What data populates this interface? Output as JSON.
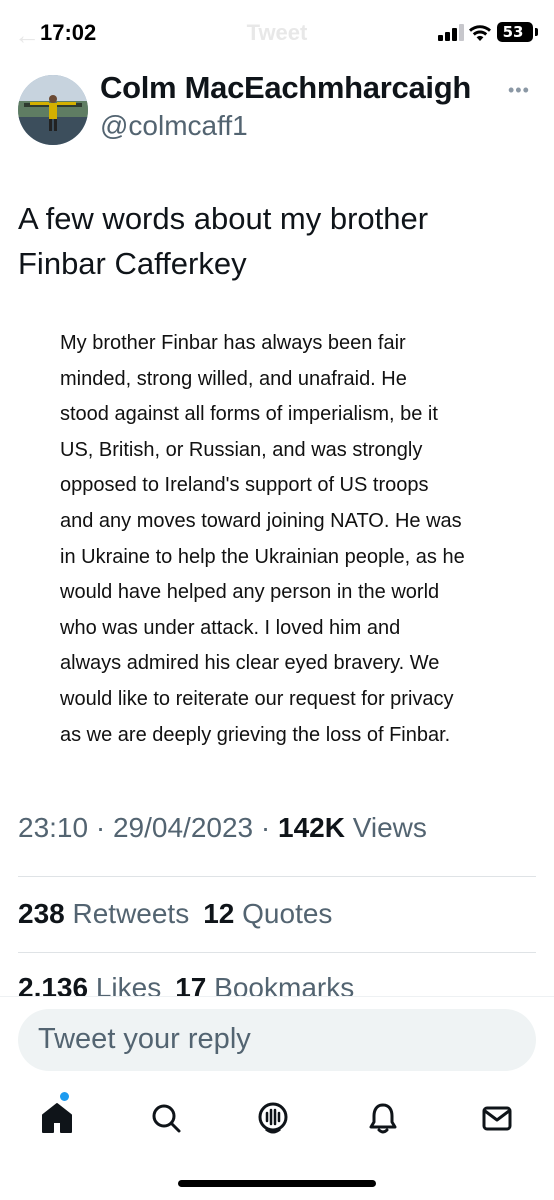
{
  "status_bar": {
    "time": "17:02",
    "battery": "53"
  },
  "nav": {
    "title": "Tweet",
    "back_icon": "back-arrow-icon"
  },
  "tweet": {
    "author": {
      "display_name": "Colm MacEachmharcaigh",
      "handle": "@colmcaff1"
    },
    "more_label": "•••",
    "text_lines": [
      "A few words about my brother",
      "Finbar Cafferkey"
    ],
    "attached_text_lines": [
      "My brother Finbar has always been fair",
      "minded, strong willed, and unafraid. He",
      "stood against all forms of imperialism, be it",
      "US, British, or Russian, and was strongly",
      "opposed to Ireland's support of US troops",
      "and any moves toward joining NATO. He was",
      "in Ukraine to help the Ukrainian people, as he",
      "would have helped any person in the world",
      "who was under attack. I loved him and",
      "always admired his clear eyed bravery. We",
      "would like to reiterate our request for privacy",
      "as we are deeply grieving the loss of Finbar."
    ],
    "meta": {
      "time": "23:10",
      "sep1": " · ",
      "date": "29/04/2023",
      "sep2": " · ",
      "views_count": "142K",
      "views_label": " Views"
    },
    "stats": {
      "retweets_count": "238",
      "retweets_label": " Retweets",
      "quotes_count": "12",
      "quotes_label": " Quotes",
      "likes_count": "2,136",
      "likes_label": " Likes",
      "bookmarks_count": "17",
      "bookmarks_label": " Bookmarks"
    }
  },
  "reply": {
    "placeholder": "Tweet your reply"
  },
  "tab_bar": {
    "items": [
      {
        "icon": "home-icon",
        "active": true
      },
      {
        "icon": "search-icon",
        "active": false
      },
      {
        "icon": "spaces-icon",
        "active": false
      },
      {
        "icon": "notifications-icon",
        "active": false
      },
      {
        "icon": "messages-icon",
        "active": false
      }
    ]
  },
  "colors": {
    "text_primary": "#0f1419",
    "text_secondary": "#536471",
    "accent": "#1d9bf0",
    "reply_bg": "#eff3f4"
  }
}
